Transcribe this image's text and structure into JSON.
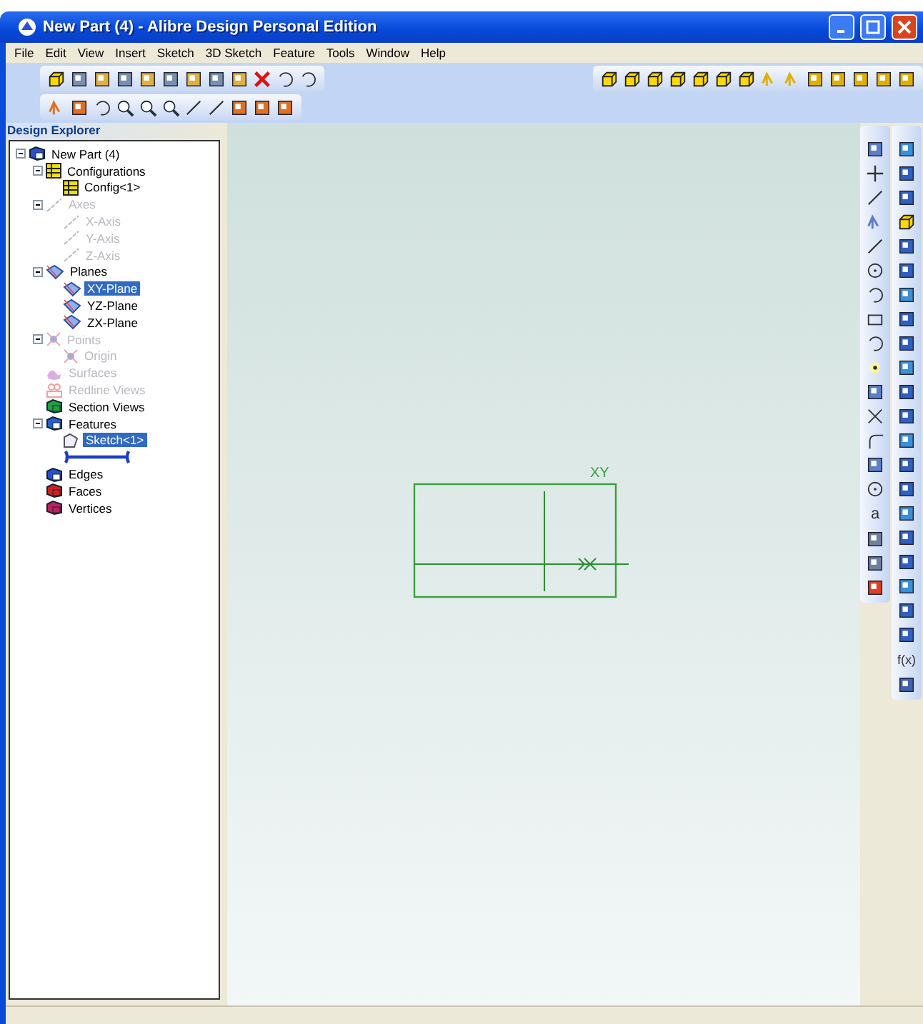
{
  "window": {
    "title": "New Part (4) - Alibre Design Personal Edition"
  },
  "menu": [
    "File",
    "Edit",
    "View",
    "Insert",
    "Sketch",
    "3D Sketch",
    "Feature",
    "Tools",
    "Window",
    "Help"
  ],
  "explorer": {
    "title": "Design Explorer",
    "tree": [
      {
        "label": "New Part (4)",
        "kind": "part",
        "expanded": true,
        "disabled": false,
        "selected": false,
        "children": [
          {
            "label": "Configurations",
            "kind": "config",
            "expanded": true,
            "disabled": false,
            "selected": false,
            "children": [
              {
                "label": "Config<1>",
                "kind": "config",
                "disabled": false,
                "selected": false
              }
            ]
          },
          {
            "label": "Axes",
            "kind": "axis",
            "expanded": true,
            "disabled": true,
            "selected": false,
            "children": [
              {
                "label": "X-Axis",
                "kind": "axis",
                "disabled": true,
                "selected": false
              },
              {
                "label": "Y-Axis",
                "kind": "axis",
                "disabled": true,
                "selected": false
              },
              {
                "label": "Z-Axis",
                "kind": "axis",
                "disabled": true,
                "selected": false
              }
            ]
          },
          {
            "label": "Planes",
            "kind": "plane",
            "expanded": true,
            "disabled": false,
            "selected": false,
            "children": [
              {
                "label": "XY-Plane",
                "kind": "plane",
                "disabled": false,
                "selected": true
              },
              {
                "label": "YZ-Plane",
                "kind": "plane",
                "disabled": false,
                "selected": false
              },
              {
                "label": "ZX-Plane",
                "kind": "plane",
                "disabled": false,
                "selected": false
              }
            ]
          },
          {
            "label": "Points",
            "kind": "point",
            "expanded": true,
            "disabled": true,
            "selected": false,
            "children": [
              {
                "label": "Origin",
                "kind": "point",
                "disabled": true,
                "selected": false
              }
            ]
          },
          {
            "label": "Surfaces",
            "kind": "surface",
            "disabled": true,
            "selected": false
          },
          {
            "label": "Redline Views",
            "kind": "redline",
            "disabled": true,
            "selected": false
          },
          {
            "label": "Section Views",
            "kind": "section",
            "disabled": false,
            "selected": false
          },
          {
            "label": "Features",
            "kind": "features",
            "expanded": true,
            "disabled": false,
            "selected": false,
            "children": [
              {
                "label": "Sketch<1>",
                "kind": "sketch",
                "disabled": false,
                "selected": true
              },
              {
                "kind": "rollback"
              }
            ]
          },
          {
            "label": "Edges",
            "kind": "edges",
            "disabled": false,
            "selected": false
          },
          {
            "label": "Faces",
            "kind": "faces",
            "disabled": false,
            "selected": false
          },
          {
            "label": "Vertices",
            "kind": "vertices",
            "disabled": false,
            "selected": false
          }
        ]
      }
    ]
  },
  "canvas": {
    "sketch_label": "XY"
  },
  "right_toolbar": {
    "text_tool": "a",
    "function_tool": "f(x)"
  }
}
